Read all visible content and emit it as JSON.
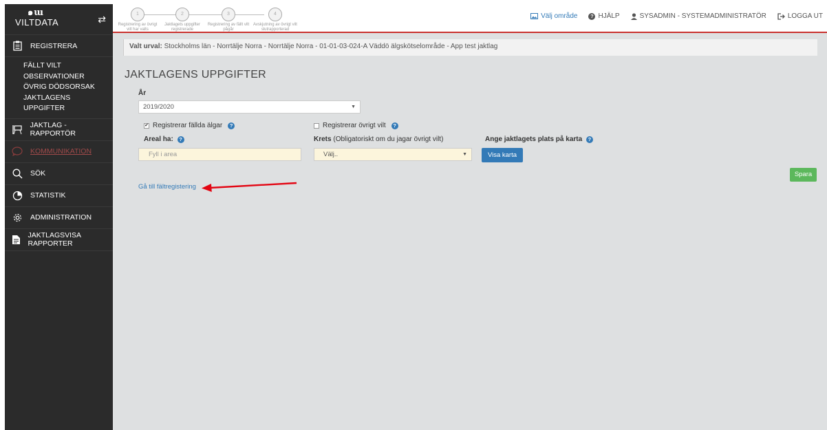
{
  "sidebar": {
    "logo_text": "VILTDATA",
    "logo_mark": "๑ɯ",
    "sections": [
      {
        "label": "REGISTRERA",
        "icon": "clipboard-icon"
      },
      {
        "label": "JAKTLAG - RAPPORTÖR",
        "icon": "easel-icon"
      },
      {
        "label": "KOMMUNIKATION",
        "icon": "chat-bubble-icon"
      },
      {
        "label": "SÖK",
        "icon": "search-icon"
      },
      {
        "label": "STATISTIK",
        "icon": "pie-chart-icon"
      },
      {
        "label": "ADMINISTRATION",
        "icon": "gear-icon"
      },
      {
        "label": "JAKTLAGSVISA RAPPORTER",
        "icon": "document-icon"
      }
    ],
    "sub_items": [
      "FÄLLT VILT",
      "OBSERVATIONER",
      "ÖVRIG DÖDSORSAK",
      "JAKTLAGENS UPPGIFTER"
    ]
  },
  "steps": [
    {
      "num": "1",
      "label": "Registrering av övrigt vilt har valts"
    },
    {
      "num": "2",
      "label": "Jaktlagets uppgifter registrerade"
    },
    {
      "num": "3",
      "label": "Registrering av fällt vilt pågår"
    },
    {
      "num": "4",
      "label": "Avskjutning av övrigt vilt slutrapporterad"
    }
  ],
  "topbar": {
    "choose_area": "Välj område",
    "help": "HJÄLP",
    "user": "SYSADMIN - SYSTEMADMINISTRATÖR",
    "logout": "LOGGA UT"
  },
  "selection": {
    "label": "Valt urval:",
    "value": "Stockholms län - Norrtälje Norra - Norrtälje Norra - 01-01-03-024-A Väddö älgskötselområde - App test jaktlag"
  },
  "form": {
    "title": "JAKTLAGENS UPPGIFTER",
    "year_label": "År",
    "year_value": "2019/2020",
    "chk_moose_label": "Registrerar fällda älgar",
    "chk_moose_checked": true,
    "chk_other_label": "Registrerar övrigt vilt",
    "chk_other_checked": false,
    "area_label": "Areal ha:",
    "area_placeholder": "Fyll i area",
    "krets_label": "Krets",
    "krets_note": "(Obligatoriskt om du jagar övrigt vilt)",
    "krets_value": "Välj..",
    "map_label": "Ange jaktlagets plats på karta",
    "map_button": "Visa karta",
    "save_button": "Spara",
    "field_link": "Gå till fältregistering"
  },
  "colors": {
    "sidebar_bg": "#2b2b2b",
    "accent_red": "#c9302c",
    "link_blue": "#337ab7",
    "save_green": "#5cb85c",
    "annotation_arrow": "#e30613"
  }
}
